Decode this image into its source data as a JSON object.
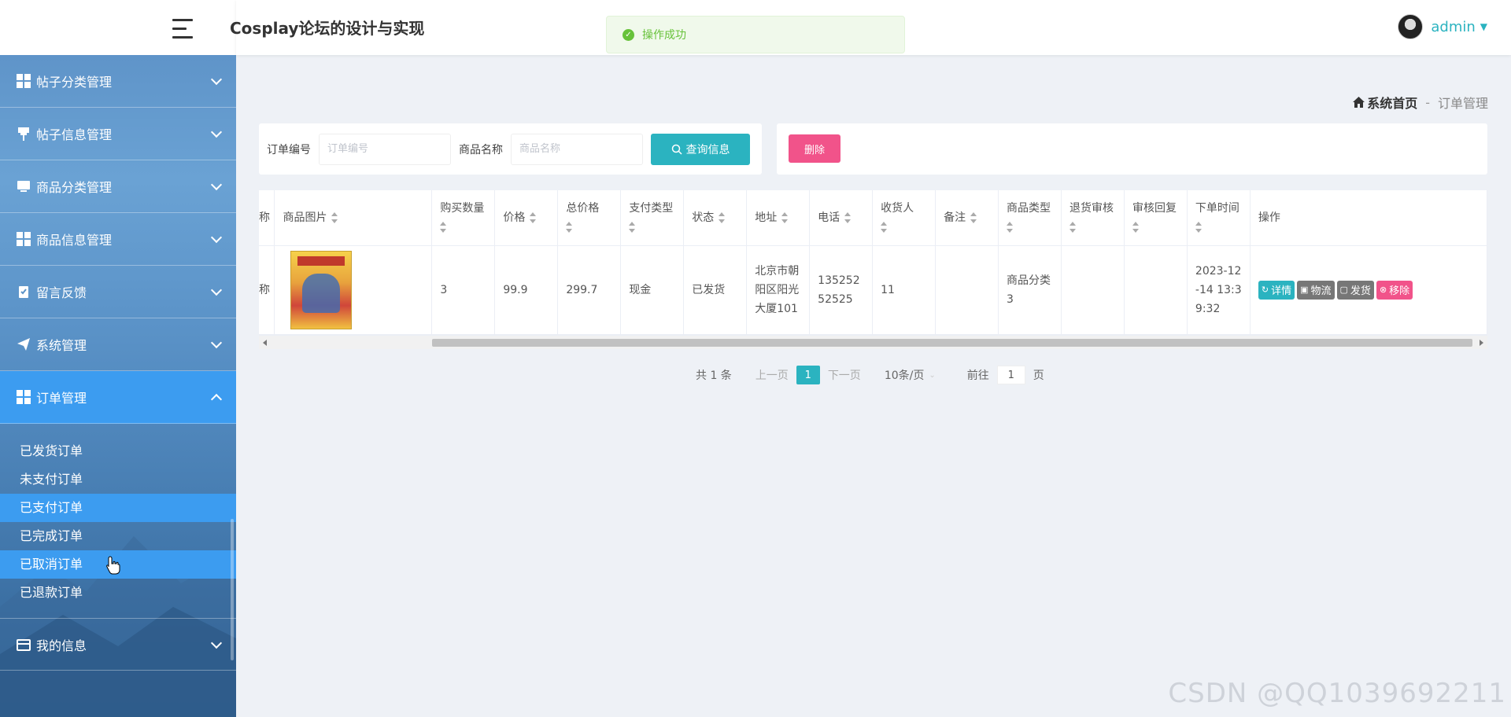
{
  "header": {
    "app_title": "Cosplay论坛的设计与实现",
    "toast": "操作成功",
    "user": "admin"
  },
  "sidebar": {
    "items": [
      {
        "label": "帖子分类管理",
        "icon": "grid-icon"
      },
      {
        "label": "帖子信息管理",
        "icon": "pushpin-icon"
      },
      {
        "label": "商品分类管理",
        "icon": "monitor-icon"
      },
      {
        "label": "商品信息管理",
        "icon": "grid-icon"
      },
      {
        "label": "留言反馈",
        "icon": "clipboard-icon"
      },
      {
        "label": "系统管理",
        "icon": "send-icon"
      },
      {
        "label": "订单管理",
        "icon": "grid-icon"
      }
    ],
    "order_submenu": [
      "已发货订单",
      "未支付订单",
      "已支付订单",
      "已完成订单",
      "已取消订单",
      "已退款订单"
    ],
    "my_info": "我的信息"
  },
  "breadcrumb": {
    "home": "系统首页",
    "separator": "-",
    "current": "订单管理"
  },
  "search": {
    "order_no_label": "订单编号",
    "order_no_placeholder": "订单编号",
    "product_name_label": "商品名称",
    "product_name_placeholder": "商品名称",
    "search_button": "查询信息",
    "delete_button": "删除"
  },
  "table": {
    "partial_col": "称",
    "headers": [
      "商品图片",
      "购买数量",
      "价格",
      "总价格",
      "支付类型",
      "状态",
      "地址",
      "电话",
      "收货人",
      "备注",
      "商品类型",
      "退货审核",
      "审核回复",
      "下单时间",
      "操作"
    ],
    "row": {
      "partial": "称",
      "quantity": "3",
      "price": "99.9",
      "total": "299.7",
      "pay_type": "现金",
      "status": "已发货",
      "address": "北京市朝阳区阳光大厦101",
      "phone": "13525252525",
      "receiver": "11",
      "remark": "",
      "product_type": "商品分类3",
      "return_review": "",
      "review_reply": "",
      "order_time": "2023-12-14 13:39:32",
      "ops": [
        "详情",
        "物流",
        "发货",
        "移除"
      ]
    }
  },
  "pagination": {
    "total": "共 1 条",
    "prev": "上一页",
    "page": "1",
    "next": "下一页",
    "page_size": "10条/页",
    "goto": "前往",
    "goto_value": "1",
    "page_unit": "页"
  },
  "watermark": "CSDN @QQ1039692211",
  "colors": {
    "accent": "#2bb3c0",
    "danger": "#f1538a",
    "sidebar_active": "#3c9cf0",
    "success": "#67c23a"
  }
}
